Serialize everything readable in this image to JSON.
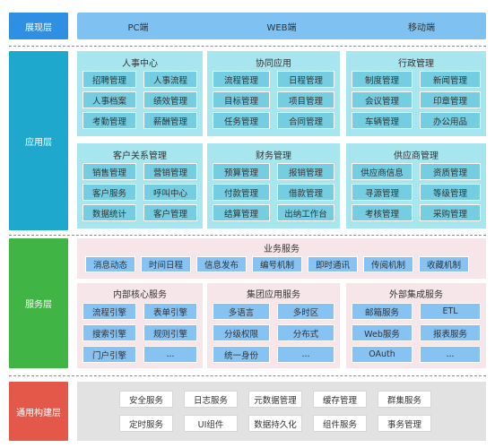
{
  "display_layer": {
    "label": "展现层",
    "items": [
      "PC端",
      "WEB端",
      "移动端"
    ]
  },
  "application_layer": {
    "label": "应用层",
    "groups": [
      {
        "title": "人事中心",
        "items": [
          "招聘管理",
          "人事流程",
          "人事档案",
          "绩效管理",
          "考勤管理",
          "薪酬管理"
        ]
      },
      {
        "title": "协同应用",
        "items": [
          "流程管理",
          "日程管理",
          "目标管理",
          "项目管理",
          "任务管理",
          "合同管理"
        ]
      },
      {
        "title": "行政管理",
        "items": [
          "制度管理",
          "新闻管理",
          "会议管理",
          "印章管理",
          "车辆管理",
          "办公用品"
        ]
      },
      {
        "title": "客户关系管理",
        "items": [
          "销售管理",
          "营销管理",
          "客户服务",
          "呼叫中心",
          "数据统计",
          "客户管理"
        ]
      },
      {
        "title": "财务管理",
        "items": [
          "预算管理",
          "报销管理",
          "付款管理",
          "借款管理",
          "结算管理",
          "出纳工作台"
        ]
      },
      {
        "title": "供应商管理",
        "items": [
          "供应商信息",
          "资质管理",
          "寻源管理",
          "等级管理",
          "考核管理",
          "采购管理"
        ]
      }
    ]
  },
  "service_layer": {
    "label": "服务层",
    "business": {
      "title": "业务服务",
      "items": [
        "消息动态",
        "时间日程",
        "信息发布",
        "编号机制",
        "即时通讯",
        "传阅机制",
        "收藏机制"
      ]
    },
    "groups": [
      {
        "title": "内部核心服务",
        "items": [
          "流程引擎",
          "表单引擎",
          "搜索引擎",
          "规则引擎",
          "门户引擎",
          "..."
        ]
      },
      {
        "title": "集团应用服务",
        "items": [
          "多语言",
          "多时区",
          "分级权限",
          "分布式",
          "统一身份",
          "..."
        ]
      },
      {
        "title": "外部集成服务",
        "items": [
          "邮箱服务",
          "ETL",
          "Web服务",
          "报表服务",
          "OAuth",
          "..."
        ]
      }
    ]
  },
  "common_layer": {
    "label": "通用构建层",
    "items": [
      "安全服务",
      "日志服务",
      "元数据管理",
      "缓存管理",
      "群集服务",
      "定时服务",
      "UI组件",
      "数据持久化",
      "组件服务",
      "事务管理"
    ]
  }
}
